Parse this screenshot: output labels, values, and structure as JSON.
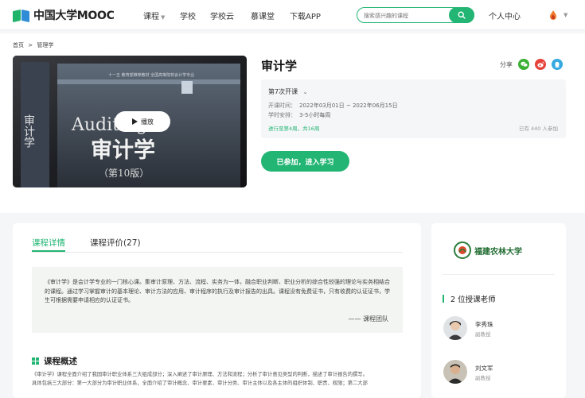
{
  "header": {
    "logo_text": "中国大学MOOC",
    "nav": [
      "课程",
      "学校",
      "学校云",
      "慕课堂",
      "下载APP"
    ],
    "search_placeholder": "搜索感兴趣的课程",
    "user_center": "个人中心"
  },
  "breadcrumb": [
    "首页",
    ">",
    "管理学"
  ],
  "video": {
    "cover_series": "十一五 教育部推荐教材 全国高等院校会计学专业",
    "cover_english": "Auditing",
    "cover_title": "审计学",
    "cover_edition": "（第10版）",
    "cover_spine": "审计学",
    "play_label": "播放"
  },
  "course": {
    "title": "审计学",
    "share_label": "分享",
    "term": "第7次开课",
    "schedule_label": "开课时间：",
    "schedule_value": "2022年03月01日 ~ 2022年06月15日",
    "workload_label": "学时安排：",
    "workload_value": "3-5小时每周",
    "progress": "进行至第4周，共16周",
    "joined_count": "已有 440 人参加",
    "join_button": "已参加，进入学习"
  },
  "tabs": [
    "课程详情",
    "课程评价(27)"
  ],
  "intro": {
    "quote": "《审计学》是会计学专业的一门核心课。集审计原理、方法、流程、实务为一体，融合职业判断、职业分析的综合性较强的理论与实务相结合的课程。通过学习掌握审计的基本理论、审计方法的应用、审计程序的执行及审计报告的出具。课程没有免费证书，只有收费的认证证书，学生可根据需要申请相应的认证证书。",
    "author": "—— 课程团队",
    "overview_title": "课程概述",
    "overview_lines": [
      "《审计学》课程全面介绍了我国审计职业体系三大组成部分；深入阐述了审计原理、方法和流程；分析了审计意见类型的判断，描述了审计报告的撰写。",
      "具体包括三大部分：第一大部分为审计职业体系，全面介绍了审计概念、审计要素、审计分类、审计主体以及各主体的组织体制、职责、权限；第二大部"
    ]
  },
  "side": {
    "school_name": "福建农林大学",
    "teachers_title": "2 位授课老师",
    "teachers": [
      {
        "name": "李秀珠",
        "role": "副教授"
      },
      {
        "name": "刘文军",
        "role": "副教授"
      }
    ]
  },
  "colors": {
    "brand": "#22b573",
    "wechat": "#3cb034",
    "weibo": "#e6423a",
    "qq": "#36a9e1"
  }
}
